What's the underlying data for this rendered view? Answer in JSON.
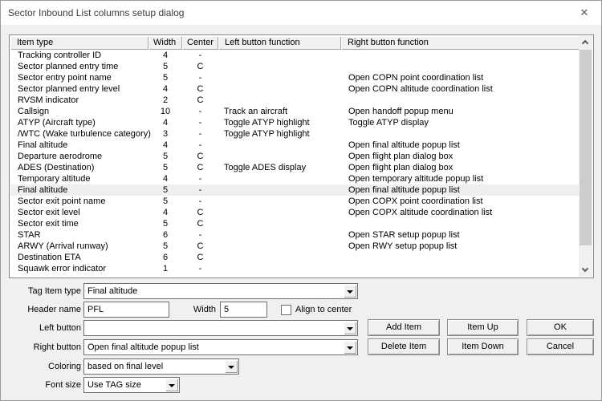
{
  "window": {
    "title": "Sector Inbound List columns setup dialog",
    "close_icon": "✕"
  },
  "colors": {
    "window_bg": "#f0f0f0",
    "titlebar_bg": "#ffffff",
    "list_bg": "#ffffff",
    "selected_row_bg": "#efefef",
    "scroll_thumb": "#cdcdcd"
  },
  "table": {
    "headers": [
      "Item type",
      "Width",
      "Center",
      "Left button function",
      "Right button function"
    ],
    "rows": [
      {
        "item": "Tracking controller ID",
        "width": "4",
        "center": "-",
        "left": "",
        "right": ""
      },
      {
        "item": "Sector planned entry time",
        "width": "5",
        "center": "C",
        "left": "",
        "right": ""
      },
      {
        "item": "Sector entry point name",
        "width": "5",
        "center": "-",
        "left": "",
        "right": "Open COPN point coordination list"
      },
      {
        "item": "Sector planned entry level",
        "width": "4",
        "center": "C",
        "left": "",
        "right": "Open COPN altitude coordination list"
      },
      {
        "item": "RVSM indicator",
        "width": "2",
        "center": "C",
        "left": "",
        "right": ""
      },
      {
        "item": "Callsign",
        "width": "10",
        "center": "-",
        "left": "Track an aircraft",
        "right": "Open handoff popup menu"
      },
      {
        "item": "ATYP (Aircraft type)",
        "width": "4",
        "center": "-",
        "left": "Toggle ATYP highlight",
        "right": "Toggle ATYP display"
      },
      {
        "item": "/WTC (Wake turbulence category)",
        "width": "3",
        "center": "-",
        "left": "Toggle ATYP highlight",
        "right": ""
      },
      {
        "item": "Final altitude",
        "width": "4",
        "center": "-",
        "left": "",
        "right": "Open final altitude popup list"
      },
      {
        "item": "Departure aerodrome",
        "width": "5",
        "center": "C",
        "left": "",
        "right": "Open flight plan dialog box"
      },
      {
        "item": "ADES (Destination)",
        "width": "5",
        "center": "C",
        "left": "Toggle ADES display",
        "right": "Open flight plan dialog box"
      },
      {
        "item": "Temporary altitude",
        "width": "4",
        "center": "-",
        "left": "",
        "right": "Open temporary altitude popup list"
      },
      {
        "item": "Final altitude",
        "width": "5",
        "center": "-",
        "left": "",
        "right": "Open final altitude popup list",
        "selected": true
      },
      {
        "item": "Sector exit point name",
        "width": "5",
        "center": "-",
        "left": "",
        "right": "Open COPX point coordination list"
      },
      {
        "item": "Sector exit level",
        "width": "4",
        "center": "C",
        "left": "",
        "right": "Open COPX altitude coordination list"
      },
      {
        "item": "Sector exit time",
        "width": "5",
        "center": "C",
        "left": "",
        "right": ""
      },
      {
        "item": "STAR",
        "width": "6",
        "center": "-",
        "left": "",
        "right": "Open STAR setup popup list"
      },
      {
        "item": "ARWY (Arrival runway)",
        "width": "5",
        "center": "C",
        "left": "",
        "right": "Open RWY setup popup list"
      },
      {
        "item": "Destination ETA",
        "width": "6",
        "center": "C",
        "left": "",
        "right": ""
      },
      {
        "item": "Squawk error indicator",
        "width": "1",
        "center": "-",
        "left": "",
        "right": ""
      }
    ]
  },
  "form": {
    "tag_item_type": {
      "label": "Tag Item type",
      "value": "Final altitude"
    },
    "header_name": {
      "label": "Header name",
      "value": "PFL"
    },
    "width_field": {
      "label": "Width",
      "value": "5"
    },
    "align_checkbox": {
      "label": "Align to center",
      "checked": false
    },
    "left_button": {
      "label": "Left button",
      "value": ""
    },
    "right_button": {
      "label": "Right button",
      "value": "Open final altitude popup list"
    },
    "coloring": {
      "label": "Coloring",
      "value": "based on final level"
    },
    "font_size": {
      "label": "Font size",
      "value": "Use TAG size"
    }
  },
  "buttons": {
    "add": "Add Item",
    "delete": "Delete Item",
    "up": "Item Up",
    "down": "Item Down",
    "ok": "OK",
    "cancel": "Cancel"
  }
}
